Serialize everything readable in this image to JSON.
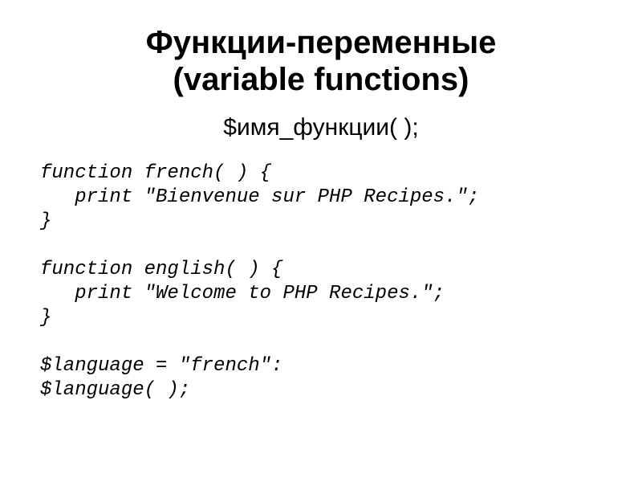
{
  "title_line1": "Функции-переменные",
  "title_line2": "(variable functions)",
  "syntax": "$имя_функции( );",
  "code": "function french( ) {\n   print \"Bienvenue sur PHP Recipes.\";\n}\n\nfunction english( ) {\n   print \"Welcome to PHP Recipes.\";\n}\n\n$language = \"french\":\n$language( );"
}
